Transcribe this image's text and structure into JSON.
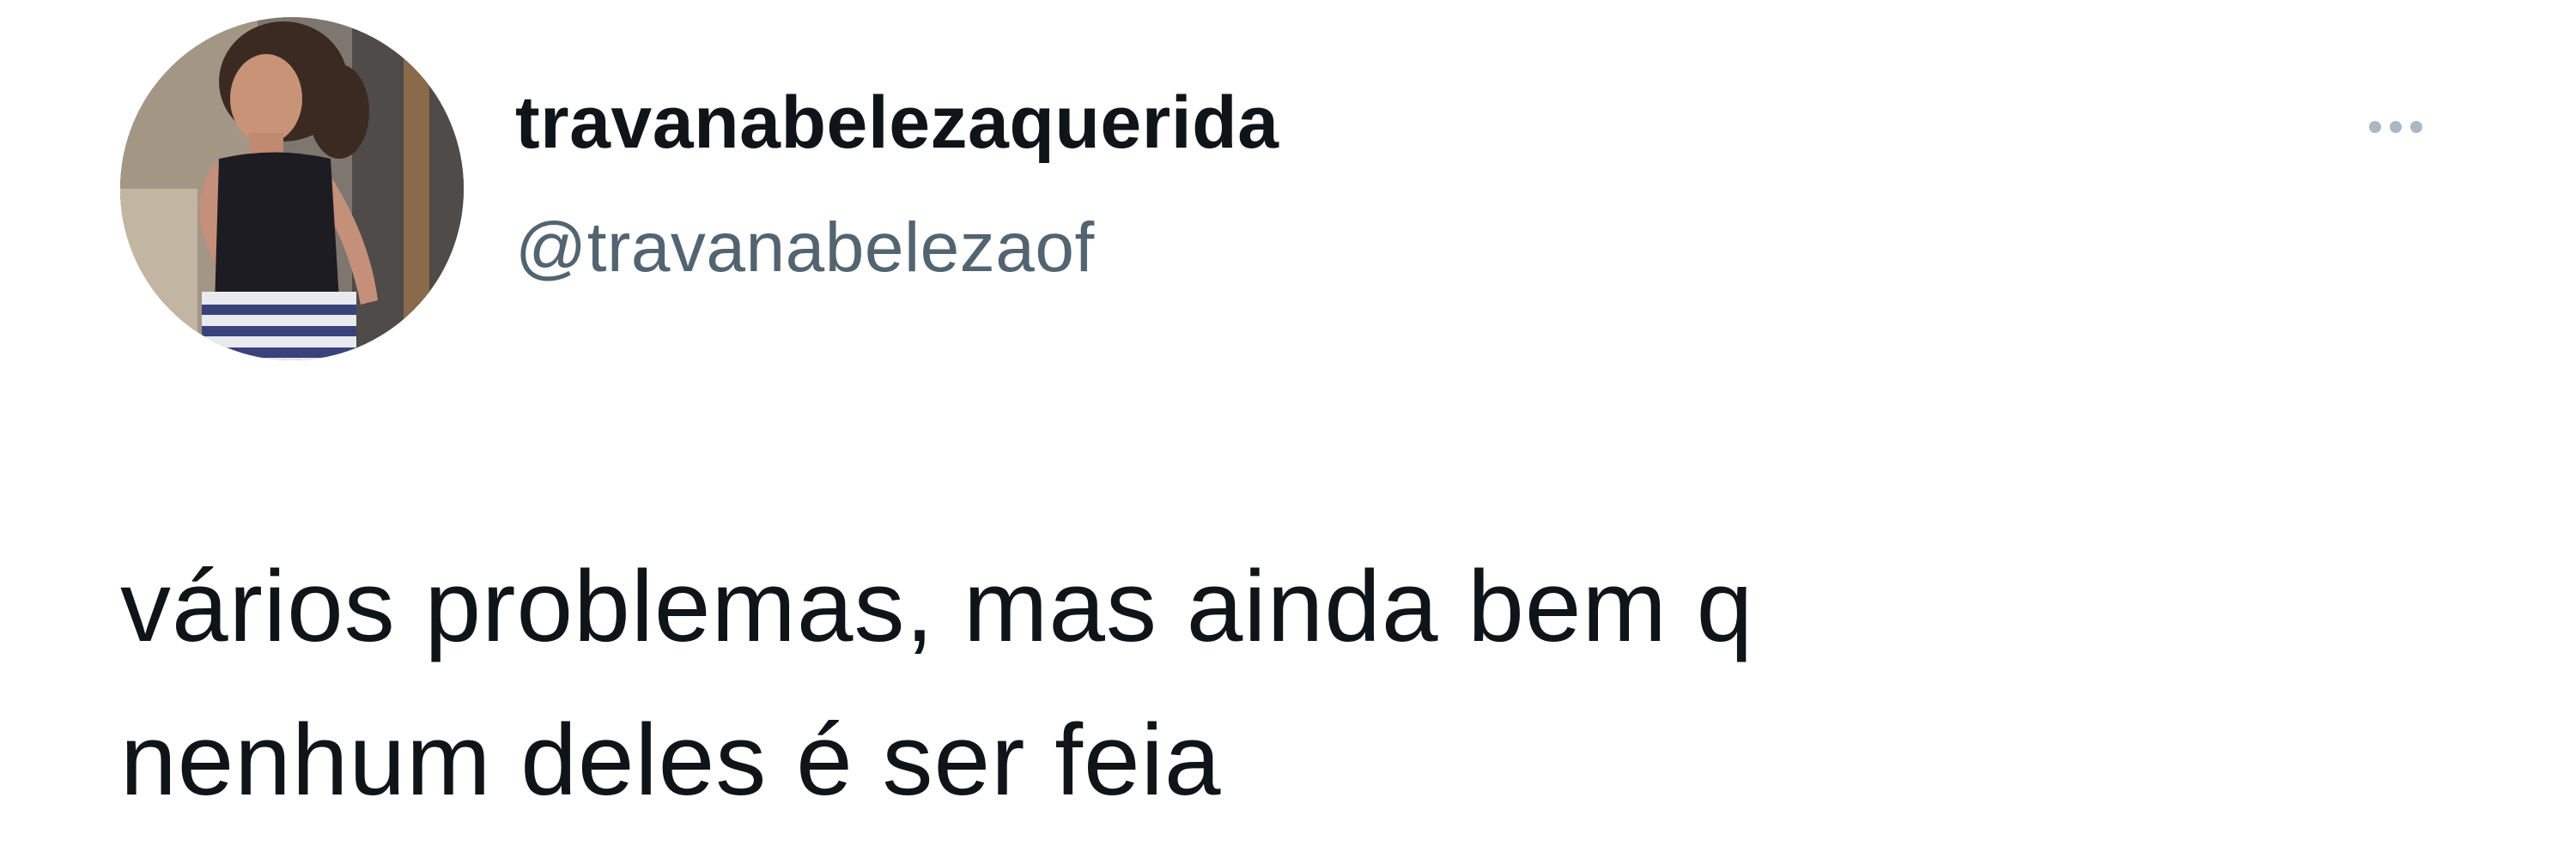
{
  "user": {
    "display_name": "travanabelezaquerida",
    "handle": "@travanabelezaof"
  },
  "tweet": {
    "lines": [
      "vários problemas, mas ainda bem q",
      "nenhum deles é ser feia"
    ]
  },
  "icons": {
    "more": "more-horizontal-icon",
    "avatar": "profile-photo"
  },
  "colors": {
    "text": "#0f1419",
    "secondary_text": "#536471",
    "more_dots": "#aab8c2",
    "background": "#ffffff"
  }
}
